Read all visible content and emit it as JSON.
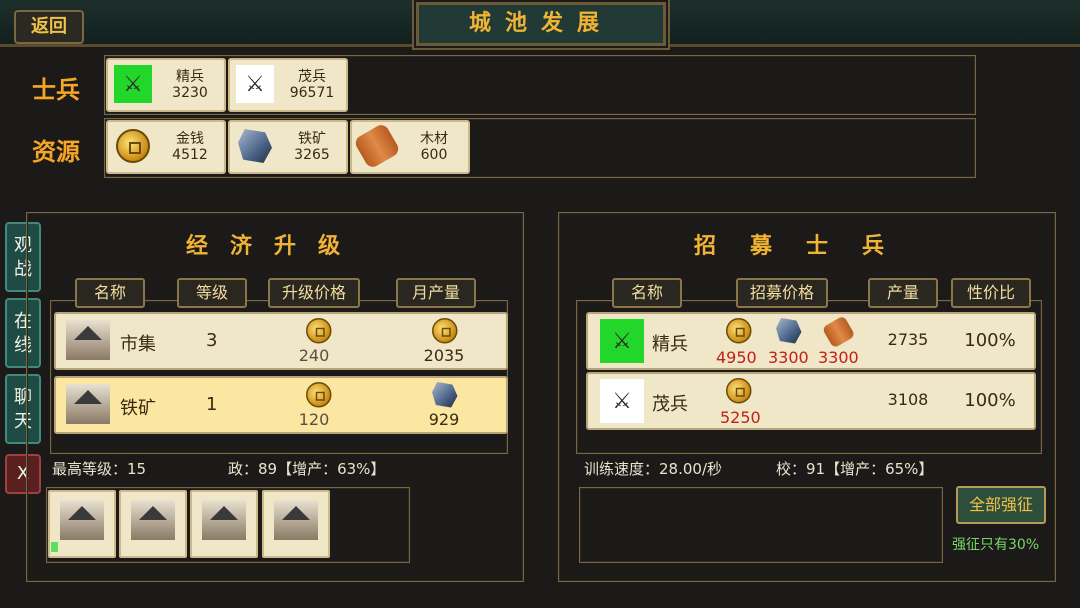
{
  "header": {
    "back_label": "返回",
    "title": "城池发展"
  },
  "sections": {
    "soldiers_label": "士兵",
    "resources_label": "资源"
  },
  "soldiers": [
    {
      "name": "精兵",
      "value": "3230",
      "icon": "elite-soldier-icon"
    },
    {
      "name": "茂兵",
      "value": "96571",
      "icon": "infantry-soldier-icon"
    }
  ],
  "resources": [
    {
      "name": "金钱",
      "value": "4512",
      "icon": "gold-coin-icon"
    },
    {
      "name": "铁矿",
      "value": "3265",
      "icon": "iron-ore-icon"
    },
    {
      "name": "木材",
      "value": "600",
      "icon": "wood-log-icon"
    }
  ],
  "side_buttons": [
    {
      "label": "观战"
    },
    {
      "label": "在线"
    },
    {
      "label": "聊天"
    },
    {
      "label": "X"
    }
  ],
  "economy": {
    "title": "经济升级",
    "headers": [
      "名称",
      "等级",
      "升级价格",
      "月产量"
    ],
    "rows": [
      {
        "name": "市集",
        "level": "3",
        "price": "240",
        "output": "2035"
      },
      {
        "name": "铁矿",
        "level": "1",
        "price": "120",
        "output": "929"
      }
    ],
    "max_level": "最高等级：15",
    "politics": "政：89【增产：63%】"
  },
  "recruit": {
    "title": "招募士兵",
    "headers": [
      "名称",
      "招募价格",
      "产量",
      "性价比"
    ],
    "rows": [
      {
        "name": "精兵",
        "costs": [
          "4950",
          "3300",
          "3300"
        ],
        "output": "2735",
        "ratio": "100%"
      },
      {
        "name": "茂兵",
        "costs": [
          "5250"
        ],
        "output": "3108",
        "ratio": "100%"
      }
    ],
    "train_speed": "训练速度：28.00/秒",
    "school": "校：91【增产：65%】",
    "conscript_label": "全部强征",
    "conscript_note": "强征只有30%"
  },
  "colors": {
    "accent": "#f1b332",
    "label": "#f6a524",
    "cost_red": "#c2201a",
    "note_green": "#7ad66a"
  }
}
